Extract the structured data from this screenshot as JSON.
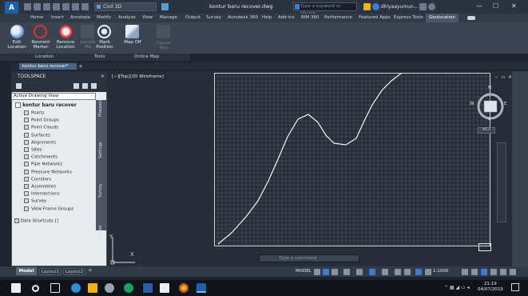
{
  "app": {
    "logo": "A",
    "workspace": "Civil 3D",
    "document_title": "kontur baru recover.dwg",
    "search_placeholder": "Type a keyword or phrase",
    "user": "dhiyaayumun...",
    "window_controls": [
      "—",
      "☐",
      "✕"
    ]
  },
  "ribbon_tabs": [
    "Home",
    "Insert",
    "Annotate",
    "Modify",
    "Analyze",
    "View",
    "Manage",
    "Output",
    "Survey",
    "Autodesk 360",
    "Help",
    "Add-ins",
    "BIM 360",
    "Performance",
    "Featured Apps",
    "Express Tools",
    "Geolocation"
  ],
  "ribbon_buttons": [
    {
      "label": "Edit\nLocation",
      "icon": "globe-pin-icon"
    },
    {
      "label": "Reorient\nMarker",
      "icon": "crosshair-marker-icon"
    },
    {
      "label": "Remove\nLocation",
      "icon": "remove-location-icon"
    },
    {
      "label": "Locate\nMe",
      "icon": "locate-me-icon"
    },
    {
      "label": "Mark\nPosition",
      "icon": "mark-position-icon"
    },
    {
      "label": "Map Off",
      "icon": "map-icon"
    },
    {
      "label": "Capture\nArea",
      "icon": "capture-area-icon"
    }
  ],
  "ribbon_panels": [
    "Location",
    "Tools",
    "Online Map"
  ],
  "doc_tab": "kontur baru recover*",
  "toolspace": {
    "title": "TOOLSPACE",
    "view": "Active Drawing View",
    "root": "kontur baru recover",
    "items": [
      "Points",
      "Point Groups",
      "Point Clouds",
      "Surfaces",
      "Alignments",
      "Sites",
      "Catchments",
      "Pipe Networks",
      "Pressure Networks",
      "Corridors",
      "Assemblies",
      "Intersections",
      "Survey",
      "View Frame Groups"
    ],
    "data_shortcuts": "Data Shortcuts []",
    "side_tabs": [
      "Prospector",
      "Settings",
      "Survey",
      "Toolbox"
    ]
  },
  "viewport": {
    "label": "[−][Top][2D Wireframe]",
    "viewcube": {
      "top": "TOP",
      "n": "N",
      "s": "S",
      "e": "E",
      "w": "W"
    },
    "ucs_name": "WCS",
    "ucs_x": "X",
    "ucs_y": "Y"
  },
  "command_line": {
    "prompt": "Type a command"
  },
  "layout_tabs": [
    "Model",
    "Layout1",
    "Layout2"
  ],
  "status": {
    "space": "MODEL",
    "scale": "1:1000"
  },
  "taskbar": {
    "time": "21:19",
    "date": "04/07/2019"
  },
  "colors": {
    "accent": "#3b7bd1",
    "canvas": "#262d38",
    "grid": "#6e7784",
    "curve": "#f2f4f6"
  }
}
